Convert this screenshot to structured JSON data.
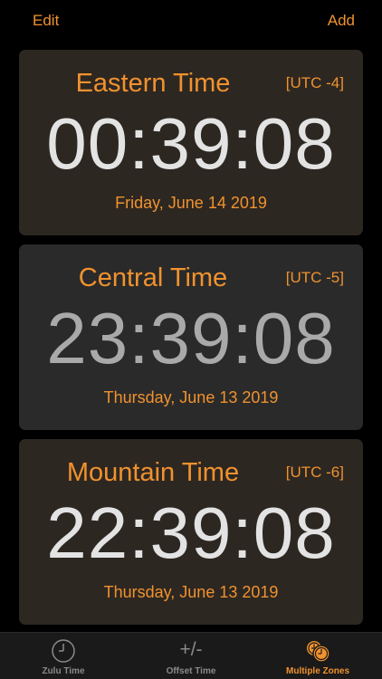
{
  "navbar": {
    "edit_label": "Edit",
    "add_label": "Add"
  },
  "zones": [
    {
      "name": "Eastern Time",
      "offset": "[UTC -4]",
      "time": "00:39:08",
      "date": "Friday, June 14 2019"
    },
    {
      "name": "Central Time",
      "offset": "[UTC -5]",
      "time": "23:39:08",
      "date": "Thursday, June 13 2019"
    },
    {
      "name": "Mountain Time",
      "offset": "[UTC -6]",
      "time": "22:39:08",
      "date": "Thursday, June 13 2019"
    }
  ],
  "tabbar": {
    "tabs": [
      {
        "label": "Zulu Time",
        "icon": "clock-icon",
        "selected": false
      },
      {
        "label": "Offset Time",
        "icon_text": "+/-",
        "icon": "plus-minus-icon",
        "selected": false
      },
      {
        "label": "Multiple Zones",
        "icon": "multiple-clocks-icon",
        "selected": true
      }
    ]
  },
  "colors": {
    "accent": "#f0922e",
    "background": "#000000",
    "card_warm": "#2d2722",
    "card_gray": "#2a2a2a",
    "time_bright": "#e3e3e3",
    "time_dim": "#a9a9a9",
    "tab_inactive": "#8a8a8a"
  }
}
